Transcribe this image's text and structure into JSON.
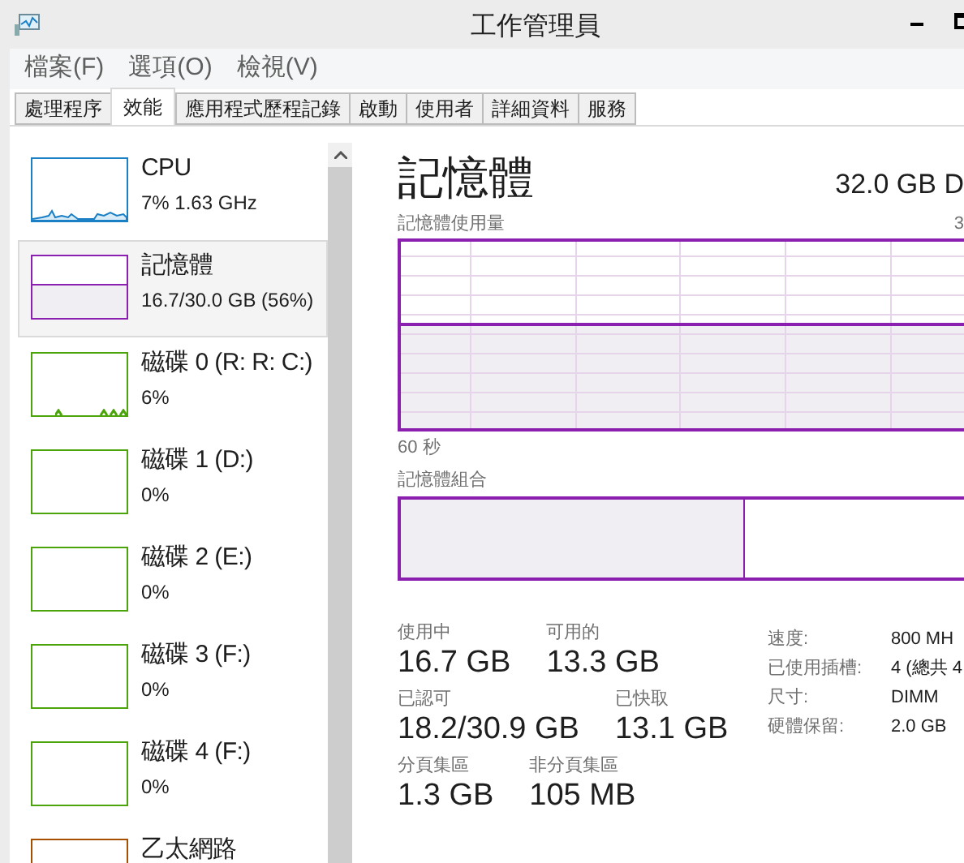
{
  "window": {
    "title": "工作管理員"
  },
  "menu": [
    "檔案(F)",
    "選項(O)",
    "檢視(V)"
  ],
  "tabs": [
    {
      "label": "處理程序",
      "selected": false
    },
    {
      "label": "效能",
      "selected": true
    },
    {
      "label": "應用程式歷程記錄",
      "selected": false
    },
    {
      "label": "啟動",
      "selected": false
    },
    {
      "label": "使用者",
      "selected": false
    },
    {
      "label": "詳細資料",
      "selected": false
    },
    {
      "label": "服務",
      "selected": false
    }
  ],
  "sidebar": {
    "items": [
      {
        "name": "CPU",
        "detail": "7% 1.63 GHz",
        "kind": "sparkline",
        "color": "#1a7fc4",
        "selected": false
      },
      {
        "name": "記憶體",
        "detail": "16.7/30.0 GB (56%)",
        "kind": "fill",
        "color": "#8b1fb0",
        "selected": true
      },
      {
        "name": "磁碟 0 (R: R: C:)",
        "detail": "6%",
        "kind": "spikes",
        "color": "#4ca40c",
        "selected": false
      },
      {
        "name": "磁碟 1 (D:)",
        "detail": "0%",
        "kind": "empty",
        "color": "#4ca40c",
        "selected": false
      },
      {
        "name": "磁碟 2 (E:)",
        "detail": "0%",
        "kind": "empty",
        "color": "#4ca40c",
        "selected": false
      },
      {
        "name": "磁碟 3 (F:)",
        "detail": "0%",
        "kind": "empty",
        "color": "#4ca40c",
        "selected": false
      },
      {
        "name": "磁碟 4 (F:)",
        "detail": "0%",
        "kind": "empty",
        "color": "#4ca40c",
        "selected": false
      },
      {
        "name": "乙太網路",
        "kind": "empty",
        "color": "#a74f01",
        "selected": false
      }
    ]
  },
  "detail": {
    "title": "記憶體",
    "capacity": "32.0 GB D",
    "usage_label": "記憶體使用量",
    "usage_max": "3",
    "time_span": "60 秒",
    "composition_label": "記憶體組合",
    "composition": {
      "level": 0.61
    },
    "stats": [
      [
        {
          "label": "使用中",
          "value": "16.7 GB"
        },
        {
          "label": "可用的",
          "value": "13.3 GB"
        }
      ],
      [
        {
          "label": "已認可",
          "value": "18.2/30.9 GB"
        },
        {
          "label": "已快取",
          "value": "13.1 GB"
        }
      ],
      [
        {
          "label": "分頁集區",
          "value": "1.3 GB"
        },
        {
          "label": "非分頁集區",
          "value": "105 MB"
        }
      ]
    ],
    "properties": [
      {
        "label": "速度:",
        "value": "800 MH"
      },
      {
        "label": "已使用插槽:",
        "value": "4 (總共 4"
      },
      {
        "label": "尺寸:",
        "value": "DIMM"
      },
      {
        "label": "硬體保留:",
        "value": "2.0 GB"
      }
    ]
  }
}
